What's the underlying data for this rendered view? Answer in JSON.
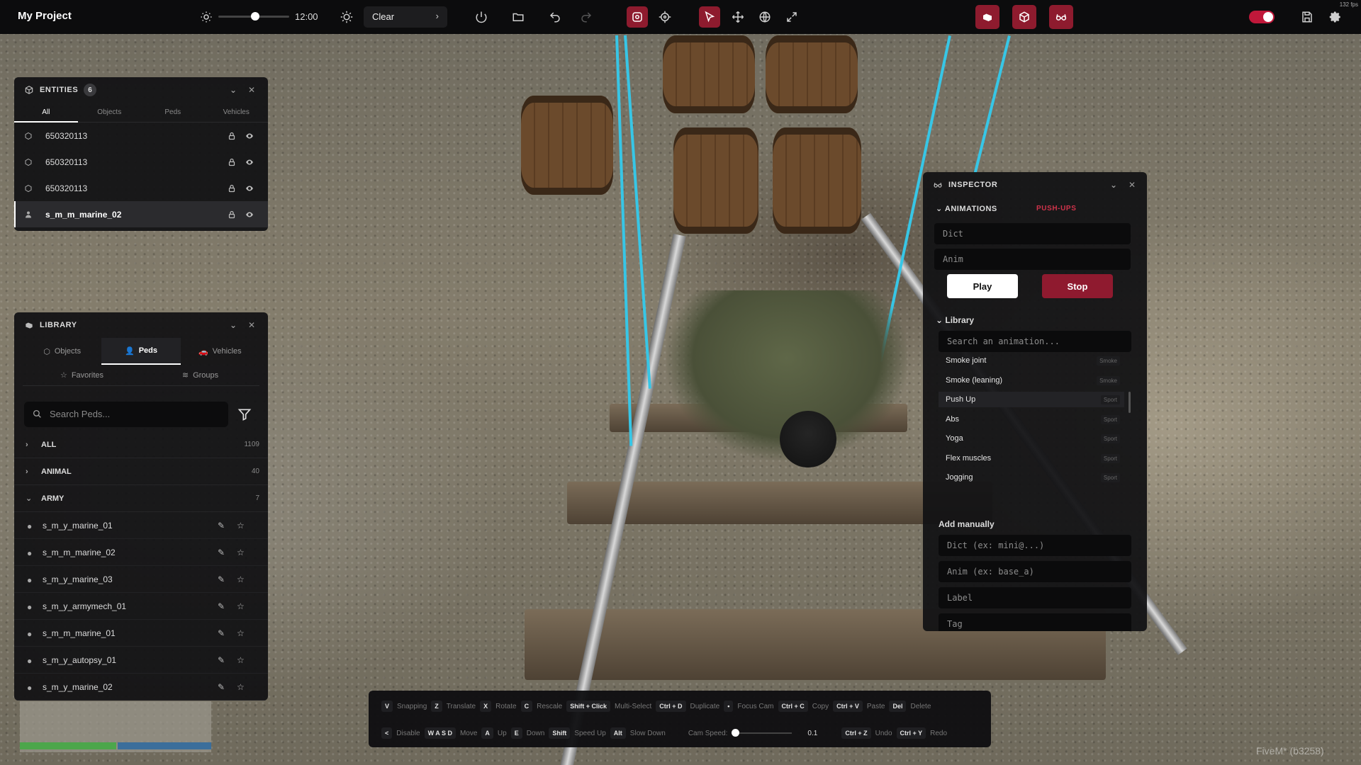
{
  "app": {
    "title": "My Project",
    "fps": "132 fps"
  },
  "topbar": {
    "time": "12:00",
    "weather": "Clear"
  },
  "entities": {
    "title": "ENTITIES",
    "count": "6",
    "tabs": [
      "All",
      "Objects",
      "Peds",
      "Vehicles"
    ],
    "rows": [
      {
        "label": "650320113",
        "type": "object"
      },
      {
        "label": "650320113",
        "type": "object"
      },
      {
        "label": "650320113",
        "type": "object"
      },
      {
        "label": "s_m_m_marine_02",
        "type": "ped",
        "selected": true
      }
    ]
  },
  "library": {
    "title": "LIBRARY",
    "tabs": [
      "Objects",
      "Peds",
      "Vehicles"
    ],
    "subtabs": [
      "Favorites",
      "Groups"
    ],
    "search_placeholder": "Search Peds...",
    "categories": [
      {
        "label": "ALL",
        "count": "1109",
        "expanded": false
      },
      {
        "label": "ANIMAL",
        "count": "40",
        "expanded": false
      },
      {
        "label": "ARMY",
        "count": "7",
        "expanded": true
      }
    ],
    "peds": [
      "s_m_y_marine_01",
      "s_m_m_marine_02",
      "s_m_y_marine_03",
      "s_m_y_armymech_01",
      "s_m_m_marine_01",
      "s_m_y_autopsy_01",
      "s_m_y_marine_02"
    ]
  },
  "inspector": {
    "title": "INSPECTOR",
    "animations_label": "ANIMATIONS",
    "current_anim": "PUSH-UPS",
    "dict_placeholder": "Dict",
    "anim_placeholder": "Anim",
    "play_label": "Play",
    "stop_label": "Stop",
    "library_label": "Library",
    "library_search_placeholder": "Search an animation...",
    "animations": [
      {
        "name": "Smoke joint",
        "tag": "Smoke"
      },
      {
        "name": "Smoke (leaning)",
        "tag": "Smoke"
      },
      {
        "name": "Push Up",
        "tag": "Sport",
        "highlighted": true
      },
      {
        "name": "Abs",
        "tag": "Sport"
      },
      {
        "name": "Yoga",
        "tag": "Sport"
      },
      {
        "name": "Flex muscles",
        "tag": "Sport"
      },
      {
        "name": "Jogging",
        "tag": "Sport"
      }
    ],
    "add_manually_label": "Add manually",
    "manual_dict_placeholder": "Dict (ex: mini@...)",
    "manual_anim_placeholder": "Anim (ex: base_a)",
    "manual_label_placeholder": "Label",
    "manual_tag_placeholder": "Tag"
  },
  "helpbar": {
    "row1": [
      {
        "key": "V",
        "label": "Snapping"
      },
      {
        "key": "Z",
        "label": "Translate"
      },
      {
        "key": "X",
        "label": "Rotate"
      },
      {
        "key": "C",
        "label": "Rescale"
      },
      {
        "key": "Shift + Click",
        "label": "Multi-Select"
      },
      {
        "key": "Ctrl + D",
        "label": "Duplicate"
      },
      {
        "key": "•",
        "label": "Focus Cam"
      },
      {
        "key": "Ctrl + C",
        "label": "Copy"
      },
      {
        "key": "Ctrl + V",
        "label": "Paste"
      },
      {
        "key": "Del",
        "label": "Delete"
      }
    ],
    "row2": [
      {
        "key": "<",
        "label": "Disable"
      },
      {
        "key": "W A S D",
        "label": "Move"
      },
      {
        "key": "A",
        "label": "Up"
      },
      {
        "key": "E",
        "label": "Down"
      },
      {
        "key": "Shift",
        "label": "Speed Up"
      },
      {
        "key": "Alt",
        "label": "Slow Down"
      }
    ],
    "cam_speed_label": "Cam Speed:",
    "cam_speed_value": "0.1",
    "row2_end": [
      {
        "key": "Ctrl + Z",
        "label": "Undo"
      },
      {
        "key": "Ctrl + Y",
        "label": "Redo"
      }
    ]
  },
  "watermark": "FiveM* (b3258)"
}
